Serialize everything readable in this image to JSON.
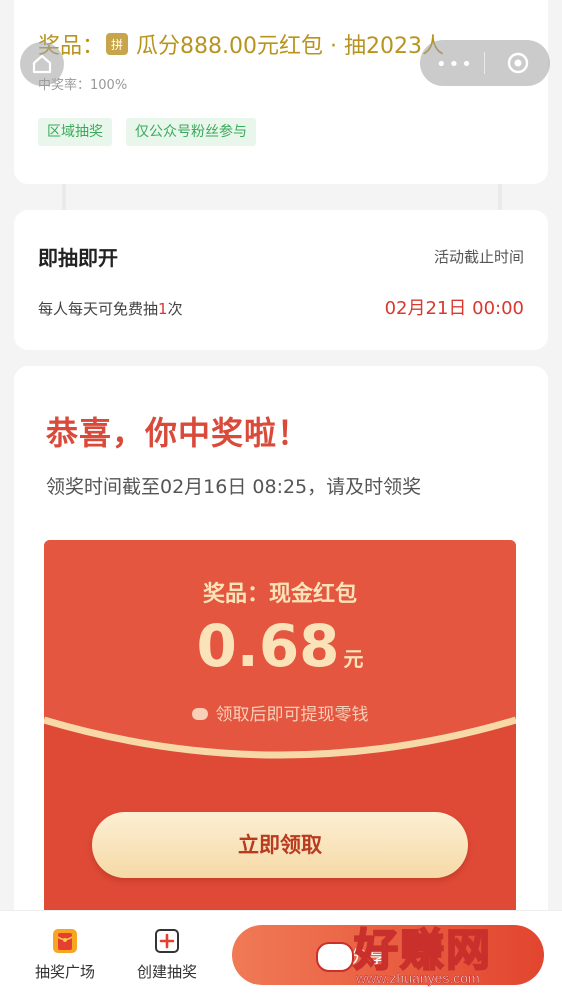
{
  "header": {
    "prize_label": "奖品：",
    "pin_badge": "拼",
    "prize_text": "瓜分888.00元红包 · 抽2023人",
    "win_rate": "中奖率：100%",
    "tags": [
      "区域抽奖",
      "仅公众号粉丝参与"
    ],
    "home_icon": "home-icon",
    "capsule_menu_icon": "more-dots-icon",
    "capsule_close_icon": "target-icon"
  },
  "draw_info": {
    "title": "即抽即开",
    "deadline_label": "活动截止时间",
    "rule_prefix": "每人每天可免费抽",
    "rule_count": "1",
    "rule_suffix": "次",
    "deadline": "02月21日 00:00"
  },
  "result": {
    "congrats": "恭喜，你中奖啦！",
    "claim_deadline": "领奖时间截至02月16日 08:25，请及时领奖",
    "prize_label": "奖品：现金红包",
    "amount": "0.68",
    "unit": "元",
    "note": "领取后即可提现零钱",
    "claim_button": "立即领取"
  },
  "bottom_nav": {
    "items": [
      {
        "label": "抽奖广场",
        "icon": "red-envelope-icon"
      },
      {
        "label": "创建抽奖",
        "icon": "plus-square-icon"
      }
    ],
    "cta_label": "分享"
  },
  "watermark": {
    "text": "好赚网",
    "url": "www.zhuanyes.com"
  },
  "colors": {
    "accent_red": "#d9382f",
    "gold": "#b8941f",
    "tag_green": "#3bab5b"
  }
}
